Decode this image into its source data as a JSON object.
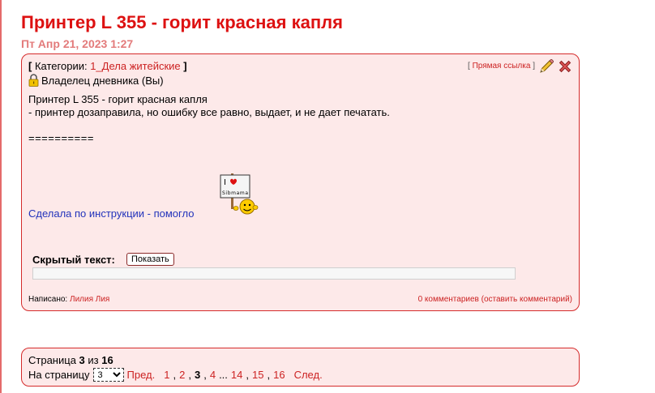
{
  "post": {
    "title": "Принтер L 355 - горит красная капля",
    "date": "Пт Апр 21, 2023 1:27",
    "categories_label": "Категории:",
    "category": "1_Дела житейские",
    "owner_label": "Владелец дневника (Вы)",
    "direct_link": "Прямая ссылка",
    "body_line1": "Принтер L 355 - горит красная капля",
    "body_line2": "- принтер дозаправила, но ошибку все равно, выдает, и не дает печатать.",
    "separator": "==========",
    "help_link": "Сделала по инструкции - помогло",
    "smiley_sign": "I ♥ Sibmama",
    "hidden_text_label": "Скрытый текст:",
    "show_button": "Показать",
    "written_label": "Написано:",
    "author": "Лилия Лия",
    "comments": "0 комментариев (оставить комментарий)"
  },
  "pager": {
    "page_word": "Страница",
    "current": "3",
    "of_word": "из",
    "total": "16",
    "goto_label": "На страницу",
    "select_value": "3",
    "prev": "Пред.",
    "pages": [
      "1",
      "2",
      "3",
      "4",
      "...",
      "14",
      "15",
      "16"
    ],
    "next": "След."
  },
  "colors": {
    "title": "#dd1111",
    "box_border": "#d52b2b",
    "box_bg": "#fde9e9",
    "link_red": "#cc2222",
    "link_blue": "#2233bb"
  },
  "icons": [
    "lock-icon",
    "pencil-edit-icon",
    "delete-x-icon",
    "smiley-sign-icon"
  ]
}
